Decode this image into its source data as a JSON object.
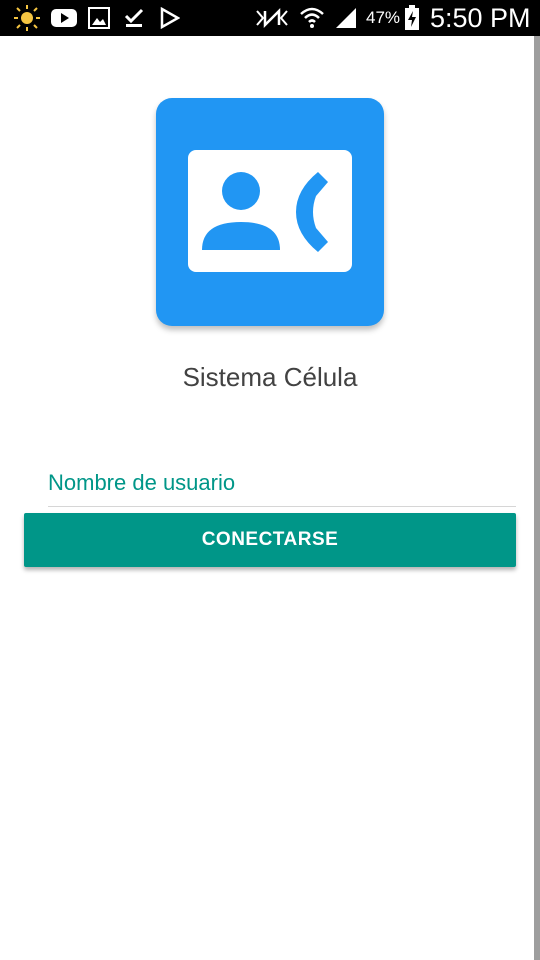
{
  "status_bar": {
    "battery_percent": "47%",
    "time": "5:50 PM",
    "left_icons": [
      "brightness-icon",
      "youtube-icon",
      "gallery-icon",
      "download-done-icon",
      "play-store-icon"
    ],
    "right_icons": [
      "nfc-icon",
      "wifi-icon",
      "signal-icon",
      "battery-charging-icon"
    ]
  },
  "app": {
    "name": "Sistema Célula",
    "logo_icon": "contact-phone-icon",
    "accent_color": "#009688",
    "logo_color": "#2196f3"
  },
  "login": {
    "username_placeholder": "Nombre de usuario",
    "username_value": "",
    "connect_label": "CONECTARSE"
  }
}
